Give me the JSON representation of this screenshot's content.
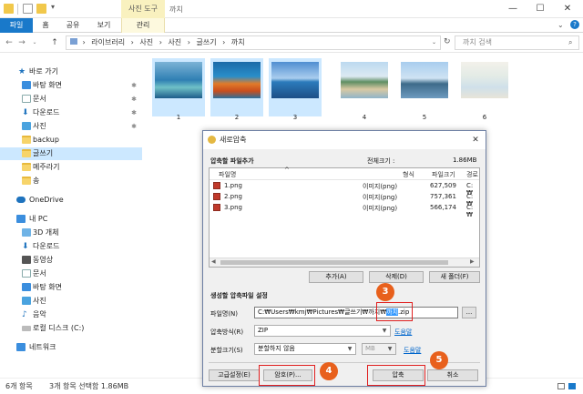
{
  "ribbon": {
    "context_tab_group": "사진 도구",
    "window_title": "까치",
    "tabs": [
      {
        "label": "파일"
      },
      {
        "label": "홈"
      },
      {
        "label": "공유"
      },
      {
        "label": "보기"
      },
      {
        "label": "관리"
      }
    ]
  },
  "address": {
    "crumbs": [
      "라이브러리",
      "사진",
      "사진",
      "글쓰기",
      "까치"
    ],
    "search_placeholder": "까치 검색"
  },
  "sidebar": {
    "items": [
      {
        "label": "바로 가기",
        "icon": "star-icon"
      },
      {
        "label": "바탕 화면",
        "icon": "desktop-icon",
        "pinned": true
      },
      {
        "label": "문서",
        "icon": "document-icon",
        "pinned": true
      },
      {
        "label": "다운로드",
        "icon": "download-icon",
        "pinned": true
      },
      {
        "label": "사진",
        "icon": "pictures-icon",
        "pinned": true
      },
      {
        "label": "backup",
        "icon": "folder-icon"
      },
      {
        "label": "글쓰기",
        "icon": "folder-icon",
        "selected": true
      },
      {
        "label": "메주라기",
        "icon": "folder-icon"
      },
      {
        "label": "송",
        "icon": "folder-icon"
      },
      {
        "label": "OneDrive",
        "icon": "cloud-icon"
      },
      {
        "label": "내 PC",
        "icon": "pc-icon"
      },
      {
        "label": "3D 개체",
        "icon": "cube-icon"
      },
      {
        "label": "다운로드",
        "icon": "download-icon"
      },
      {
        "label": "동영상",
        "icon": "video-icon"
      },
      {
        "label": "문서",
        "icon": "document-icon"
      },
      {
        "label": "바탕 화면",
        "icon": "desktop-icon"
      },
      {
        "label": "사진",
        "icon": "pictures-icon"
      },
      {
        "label": "음악",
        "icon": "music-icon"
      },
      {
        "label": "로컬 디스크 (C:)",
        "icon": "disk-icon"
      },
      {
        "label": "네트워크",
        "icon": "network-icon"
      }
    ]
  },
  "thumbnails": [
    {
      "label": "1",
      "selected": true
    },
    {
      "label": "2",
      "selected": true
    },
    {
      "label": "3",
      "selected": true
    },
    {
      "label": "4",
      "selected": false
    },
    {
      "label": "5",
      "selected": false
    },
    {
      "label": "6",
      "selected": false
    }
  ],
  "status": {
    "count": "6개 항목",
    "selection": "3개 항목 선택함 1.86MB"
  },
  "dialog": {
    "title": "새로압축",
    "files_section": "압축할 파일추가",
    "total_size_label": "전체크기 :",
    "total_size": "1.86MB",
    "columns": [
      "파일명",
      "형식",
      "파일크기",
      "경로"
    ],
    "files": [
      {
        "name": "1.png",
        "type": "이미지(png)",
        "size": "627,509",
        "path": "C:₩"
      },
      {
        "name": "2.png",
        "type": "이미지(png)",
        "size": "757,361",
        "path": "C:₩"
      },
      {
        "name": "3.png",
        "type": "이미지(png)",
        "size": "566,174",
        "path": "C:₩"
      }
    ],
    "btn_add": "추가(A)",
    "btn_delete": "삭제(D)",
    "btn_new_folder": "새 폴더(F)",
    "settings_section": "생성할 압축파일 설정",
    "filename_label": "파일명(N)",
    "filename_prefix": "C:₩Users₩kmj₩Pictures₩글쓰기₩까치₩",
    "filename_selected": "까치",
    "filename_suffix": ".zip",
    "browse_label": "...",
    "method_label": "압축방식(R)",
    "method_value": "ZIP",
    "help1": "도움말",
    "split_label": "분할크기(S)",
    "split_value": "분할하지 않음",
    "split_unit": "MB",
    "help2": "도움말",
    "btn_advanced": "고급설정(E)",
    "btn_password": "암호(P)...",
    "btn_compress": "압축",
    "btn_cancel": "취소"
  },
  "annotations": {
    "badge3": "3",
    "badge4": "4",
    "badge5": "5",
    "color": "#e8601c"
  }
}
